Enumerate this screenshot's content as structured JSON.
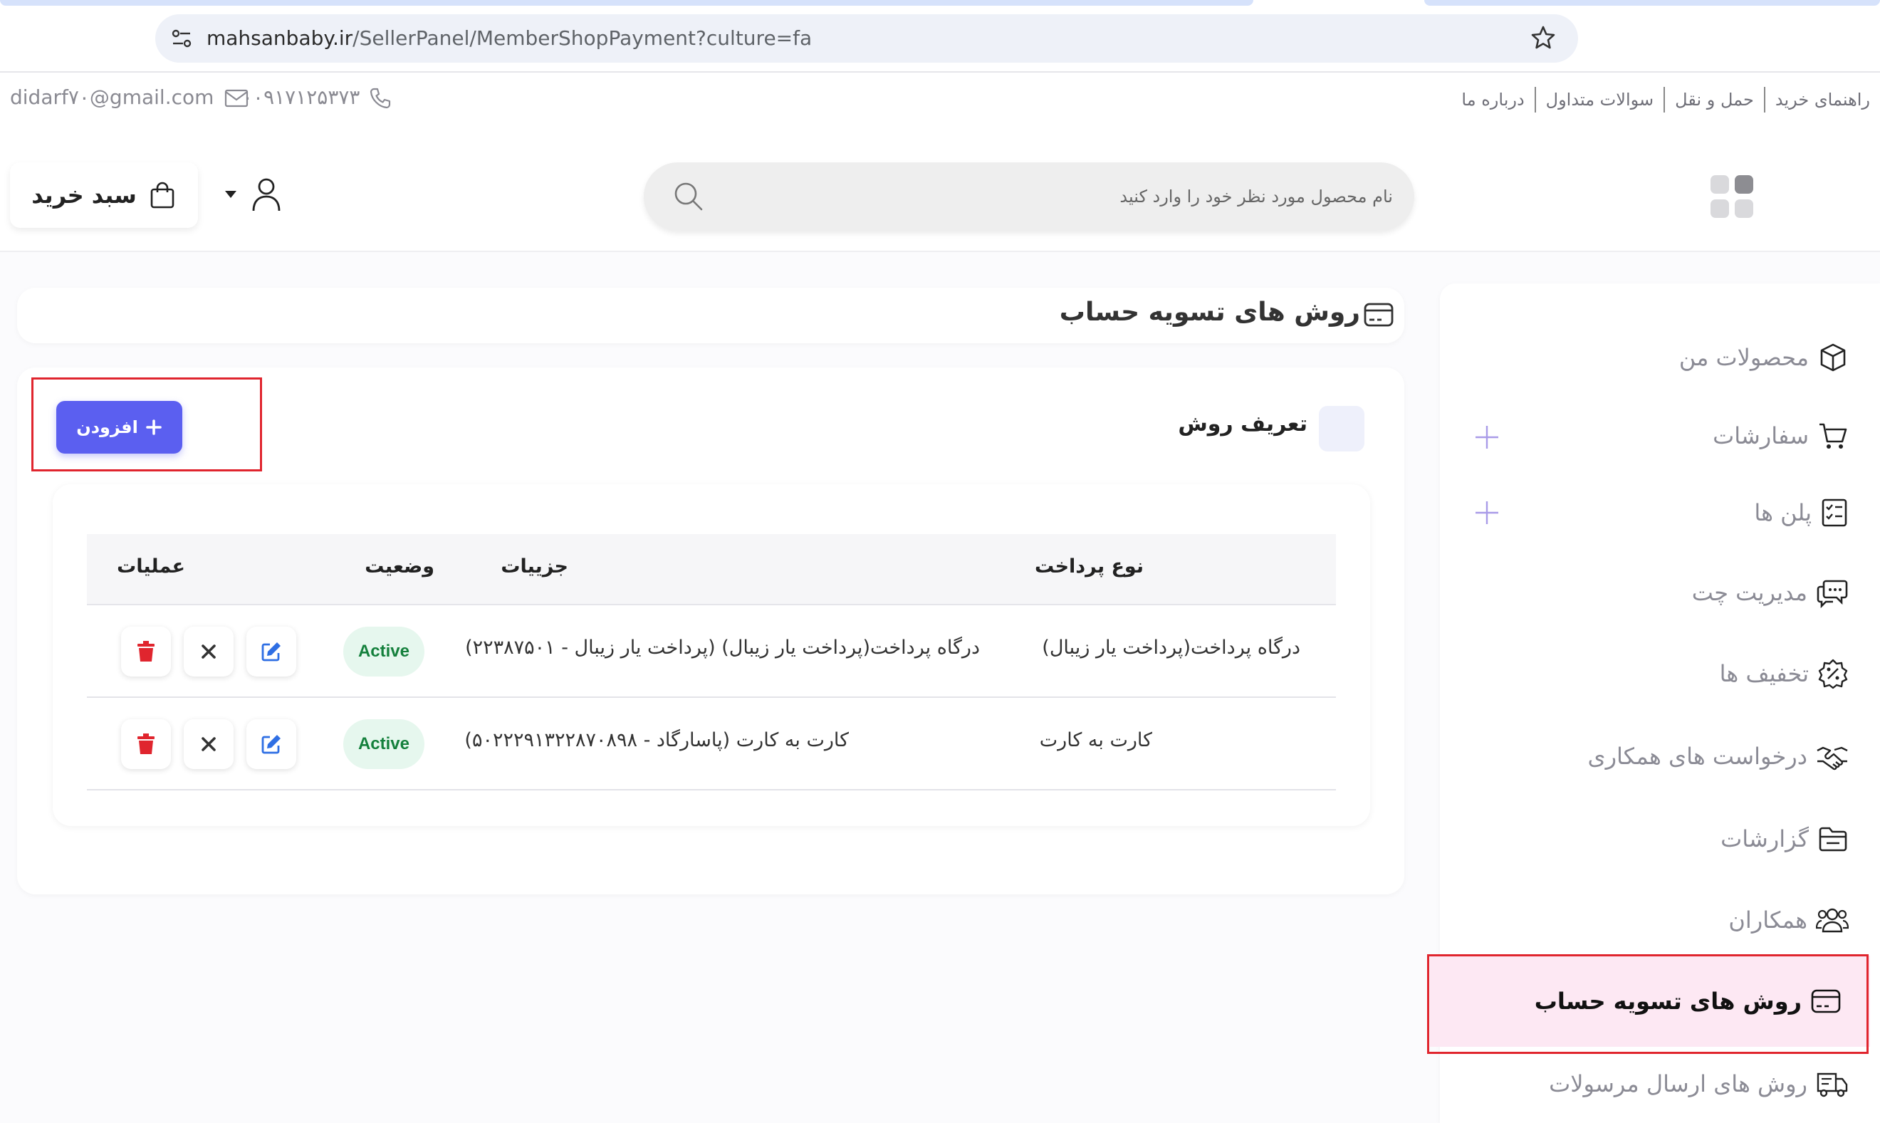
{
  "browser": {
    "url_domain": "mahsanbaby.ir",
    "url_path": "/SellerPanel/MemberShopPayment?culture=fa"
  },
  "topbar": {
    "email": "didarf۷۰@gmail.com",
    "phone": "۰۰۹۱۷۱۲۵۳۷۳",
    "links": [
      "راهنمای خرید",
      "حمل و نقل",
      "سوالات متداول",
      "درباره ما"
    ]
  },
  "header": {
    "cart_label": "سبد خرید",
    "search_placeholder": "نام محصول مورد نظر خود را وارد کنید"
  },
  "page": {
    "title": "روش های تسویه حساب",
    "section_label": "تعریف روش",
    "add_button": "افزودن"
  },
  "table": {
    "headers": {
      "payment_type": "نوع پرداخت",
      "details": "جزییات",
      "status": "وضعیت",
      "actions": "عملیات"
    },
    "rows": [
      {
        "payment_type": "درگاه پرداخت(پرداخت یار زیبال)",
        "details": "درگاه پرداخت(پرداخت یار زیبال) (پرداخت یار زیبال - ۲۲۳۸۷۵۰۱)",
        "status": "Active"
      },
      {
        "payment_type": "کارت به کارت",
        "details": "کارت به کارت (پاسارگاد - ۵۰۲۲۲۹۱۳۲۲۸۷۰۸۹۸)",
        "status": "Active"
      }
    ]
  },
  "sidebar": {
    "items": [
      {
        "label": "محصولات من",
        "icon": "box-icon"
      },
      {
        "label": "سفارشات",
        "icon": "cart-icon"
      },
      {
        "label": "پلن ها",
        "icon": "checklist-icon"
      },
      {
        "label": "مدیریت چت",
        "icon": "chat-icon"
      },
      {
        "label": "تخفیف ها",
        "icon": "discount-icon"
      },
      {
        "label": "درخواست های همکاری",
        "icon": "handshake-icon"
      },
      {
        "label": "گزارشات",
        "icon": "folder-icon"
      },
      {
        "label": "همکاران",
        "icon": "users-icon"
      },
      {
        "label": "روش های تسویه حساب",
        "icon": "card-icon"
      },
      {
        "label": "روش های ارسال مرسولات",
        "icon": "truck-icon"
      }
    ]
  },
  "colors": {
    "accent": "#5b5ff0",
    "active_bg": "#fde8f3",
    "status_green": "#14803c",
    "delete_red": "#e0252e",
    "edit_blue": "#2f6fe4",
    "highlight_box": "#e0252e"
  }
}
